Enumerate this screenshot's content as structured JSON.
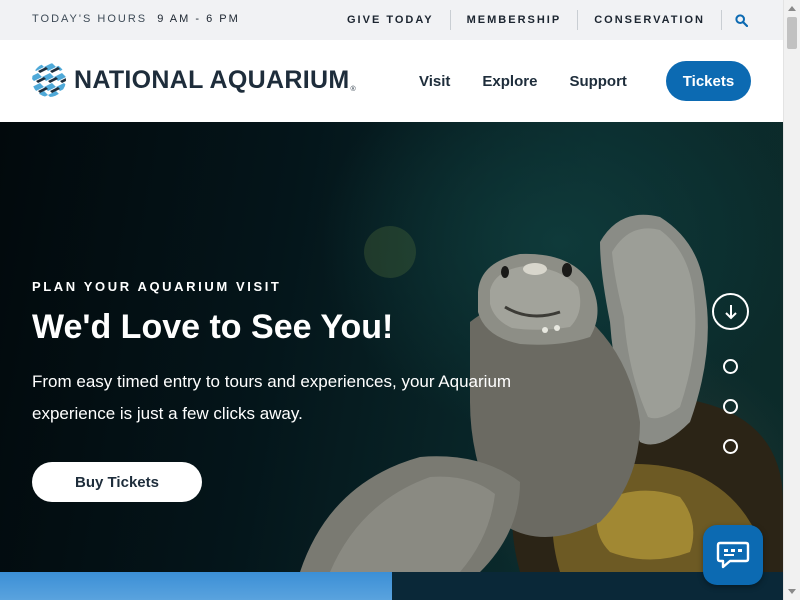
{
  "utility": {
    "hours_label": "TODAY'S HOURS",
    "hours_value": "9 AM - 6 PM",
    "links": [
      "GIVE TODAY",
      "MEMBERSHIP",
      "CONSERVATION"
    ],
    "search_icon": "search-icon"
  },
  "header": {
    "logo_text": "NATIONAL AQUARIUM",
    "logo_reg": "®",
    "nav": [
      "Visit",
      "Explore",
      "Support"
    ],
    "tickets_label": "Tickets"
  },
  "hero": {
    "eyebrow": "PLAN YOUR AQUARIUM VISIT",
    "title": "We'd Love to See You!",
    "body": "From easy timed entry to tours and experiences, your Aquarium experience is just a few clicks away.",
    "button_label": "Buy Tickets",
    "scroll_icon": "arrow-down-icon",
    "slide_dots": 3
  },
  "chat": {
    "icon": "chat-icon"
  },
  "colors": {
    "brand_blue": "#0c6ab2",
    "navy_text": "#1e2d3b",
    "utility_bg": "#f1f2f4",
    "hero_dark": "#04151a"
  }
}
